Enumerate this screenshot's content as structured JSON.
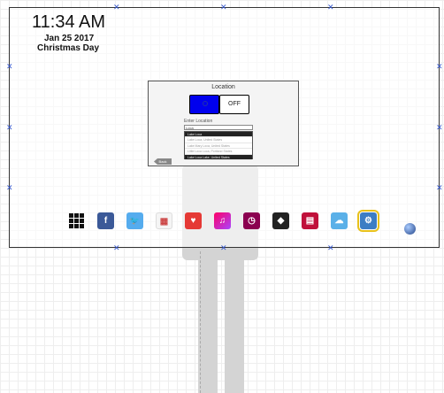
{
  "clock": {
    "time": "11:34 AM",
    "date": "Jan 25 2017",
    "holiday": "Christmas Day"
  },
  "location_dialog": {
    "title": "Location",
    "toggle_off_label": "OFF",
    "enter_label": "Enter Location",
    "input_value": "Loca",
    "suggestions": [
      "Lake Loca",
      "Lake Loca, United States",
      "Lake Mary Loca, United States",
      "Little Loca Loca, Portland States",
      "Lake Loca Lake, United States"
    ],
    "back_label": "Back"
  },
  "dock_apps": [
    {
      "name": "apps-grid-icon",
      "color": "#111111"
    },
    {
      "name": "facebook-icon",
      "color": "#3b5998",
      "glyph": "f"
    },
    {
      "name": "twitter-icon",
      "color": "#55acee",
      "glyph": "🐦"
    },
    {
      "name": "calendar-icon",
      "color": "#f5f5f5",
      "glyph": "▦"
    },
    {
      "name": "health-icon",
      "color": "#e53935",
      "glyph": "♥"
    },
    {
      "name": "music-icon",
      "color": "#c850c0",
      "glyph": "♫"
    },
    {
      "name": "timer-icon",
      "color": "#8b0050",
      "glyph": "◷"
    },
    {
      "name": "cube-icon",
      "color": "#222222",
      "glyph": "◆"
    },
    {
      "name": "notes-icon",
      "color": "#c0103a",
      "glyph": "▤"
    },
    {
      "name": "weather-icon",
      "color": "#5ab0e8",
      "glyph": "☁"
    },
    {
      "name": "settings-icon",
      "color": "#3c7dc4",
      "glyph": "⚙"
    }
  ]
}
